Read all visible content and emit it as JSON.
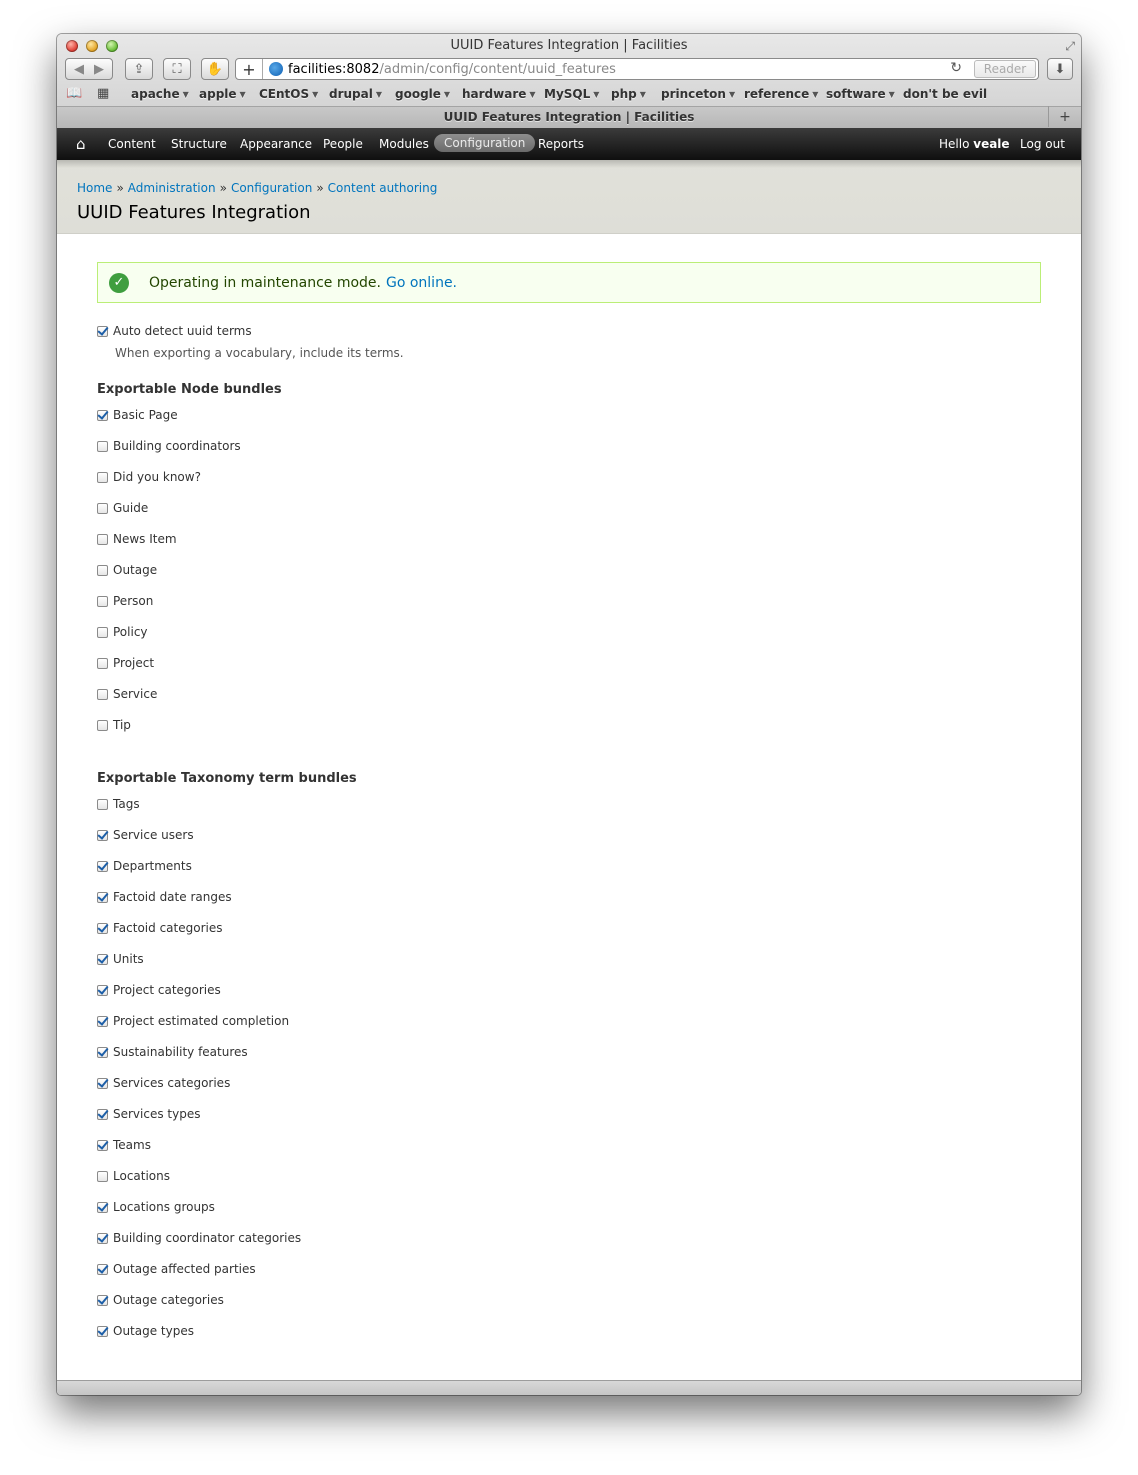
{
  "window": {
    "title": "UUID Features Integration | Facilities"
  },
  "address_bar": {
    "host": "facilities:8082",
    "path": "/admin/config/content/uuid_features",
    "reader_label": "Reader"
  },
  "bookmarks": [
    {
      "label": "apache"
    },
    {
      "label": "apple"
    },
    {
      "label": "CEntOS"
    },
    {
      "label": "drupal"
    },
    {
      "label": "google"
    },
    {
      "label": "hardware"
    },
    {
      "label": "MySQL"
    },
    {
      "label": "php"
    },
    {
      "label": "princeton"
    },
    {
      "label": "reference"
    },
    {
      "label": "software"
    },
    {
      "label": "don't be evil"
    }
  ],
  "tab": {
    "label": "UUID Features Integration | Facilities"
  },
  "admin_menu": {
    "items": [
      {
        "label": "Content"
      },
      {
        "label": "Structure"
      },
      {
        "label": "Appearance"
      },
      {
        "label": "People"
      },
      {
        "label": "Modules"
      },
      {
        "label": "Configuration"
      },
      {
        "label": "Reports"
      }
    ],
    "active_index": 5,
    "greeting": "Hello",
    "username": "veale",
    "logout": "Log out"
  },
  "breadcrumb": [
    "Home",
    "Administration",
    "Configuration",
    "Content authoring"
  ],
  "breadcrumb_sep": "»",
  "page_title": "UUID Features Integration",
  "message": {
    "text": "Operating in maintenance mode.",
    "link": "Go online."
  },
  "auto_detect": {
    "label": "Auto detect uuid terms",
    "checked": true,
    "description": "When exporting a vocabulary, include its terms."
  },
  "node_bundles": {
    "title": "Exportable Node bundles",
    "items": [
      {
        "label": "Basic Page",
        "checked": true
      },
      {
        "label": "Building coordinators",
        "checked": false
      },
      {
        "label": "Did you know?",
        "checked": false
      },
      {
        "label": "Guide",
        "checked": false
      },
      {
        "label": "News Item",
        "checked": false
      },
      {
        "label": "Outage",
        "checked": false
      },
      {
        "label": "Person",
        "checked": false
      },
      {
        "label": "Policy",
        "checked": false
      },
      {
        "label": "Project",
        "checked": false
      },
      {
        "label": "Service",
        "checked": false
      },
      {
        "label": "Tip",
        "checked": false
      }
    ]
  },
  "taxonomy_bundles": {
    "title": "Exportable Taxonomy term bundles",
    "items": [
      {
        "label": "Tags",
        "checked": false
      },
      {
        "label": "Service users",
        "checked": true
      },
      {
        "label": "Departments",
        "checked": true
      },
      {
        "label": "Factoid date ranges",
        "checked": true
      },
      {
        "label": "Factoid categories",
        "checked": true
      },
      {
        "label": "Units",
        "checked": true
      },
      {
        "label": "Project categories",
        "checked": true
      },
      {
        "label": "Project estimated completion",
        "checked": true
      },
      {
        "label": "Sustainability features",
        "checked": true
      },
      {
        "label": "Services categories",
        "checked": true
      },
      {
        "label": "Services types",
        "checked": true
      },
      {
        "label": "Teams",
        "checked": true
      },
      {
        "label": "Locations",
        "checked": false
      },
      {
        "label": "Locations groups",
        "checked": true
      },
      {
        "label": "Building coordinator categories",
        "checked": true
      },
      {
        "label": "Outage affected parties",
        "checked": true
      },
      {
        "label": "Outage categories",
        "checked": true
      },
      {
        "label": "Outage types",
        "checked": true
      }
    ]
  }
}
